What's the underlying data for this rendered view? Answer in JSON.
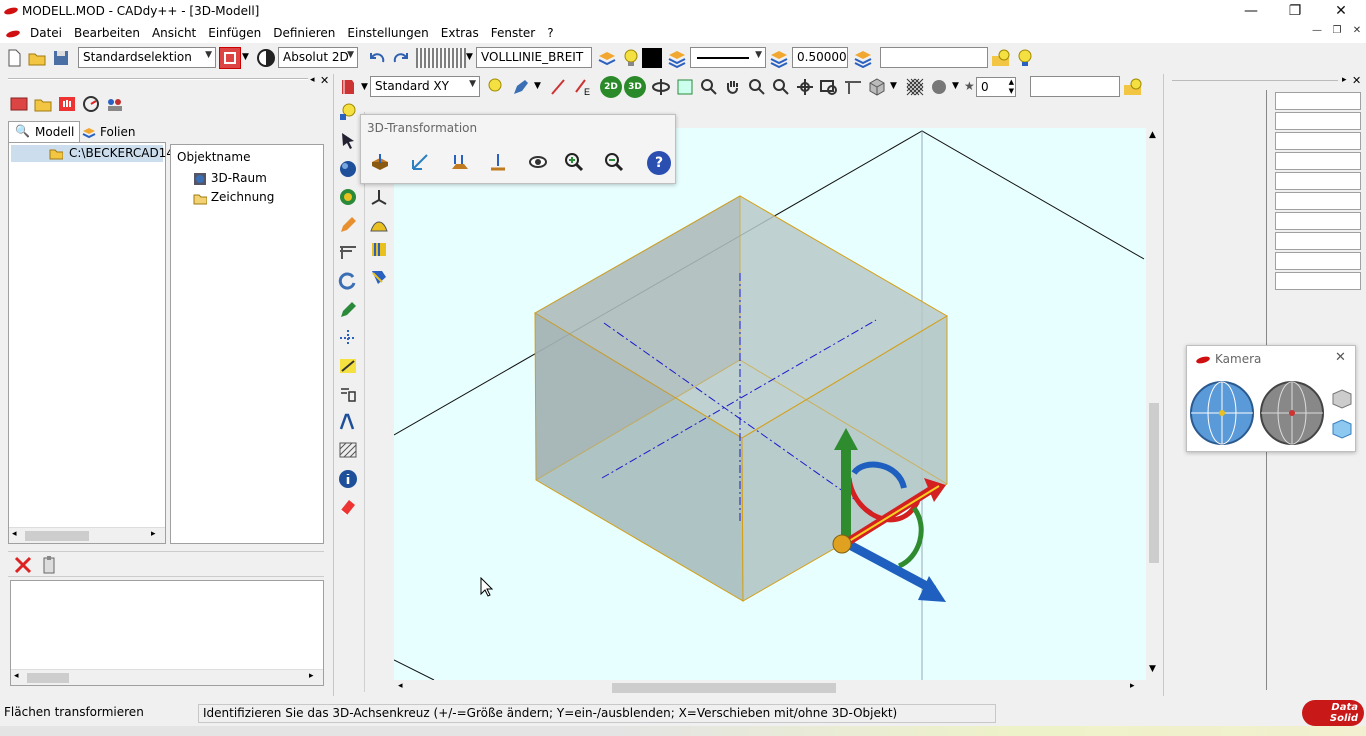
{
  "window": {
    "title": "MODELL.MOD  -  CADdy++ - [3D-Modell]",
    "minimize": "—",
    "restore": "❐",
    "close": "✕"
  },
  "menu": {
    "items": [
      "Datei",
      "Bearbeiten",
      "Ansicht",
      "Einfügen",
      "Definieren",
      "Einstellungen",
      "Extras",
      "Fenster",
      "?"
    ]
  },
  "toolbar1": {
    "selection_mode": "Standardselektion",
    "coord_mode": "Absolut 2D",
    "line_type": "VOLLLINIE_BREIT",
    "line_width": "0.500000",
    "layer_value": ""
  },
  "toolbar2": {
    "view": "Standard XY",
    "btn_2d": "2D",
    "btn_3d": "3D",
    "count_value": "0",
    "field_value": ""
  },
  "left_panel": {
    "tabs": [
      "Modell",
      "Folien"
    ],
    "path": "C:\\BECKERCAD14",
    "object_header": "Objektname",
    "objects": [
      "3D-Raum",
      "Zeichnung"
    ]
  },
  "transform_window": {
    "title": "3D-Transformation",
    "help": "?"
  },
  "camera_window": {
    "title": "Kamera",
    "close": "✕"
  },
  "statusbar": {
    "mode": "Flächen transformieren",
    "hint": "Identifizieren Sie das 3D-Achsenkreuz (+/-=Größe ändern; Y=ein-/ausblenden; X=Verschieben mit/ohne 3D-Objekt)",
    "logo_top": "Data",
    "logo_bottom": "Solid"
  },
  "colors": {
    "viewport_bg": "#e8ffff",
    "box_edge": "#d4a017",
    "axis_green": "#2e8b2e",
    "axis_red": "#d42020",
    "axis_blue": "#1f5fbf",
    "centerline": "#1a1acc"
  }
}
